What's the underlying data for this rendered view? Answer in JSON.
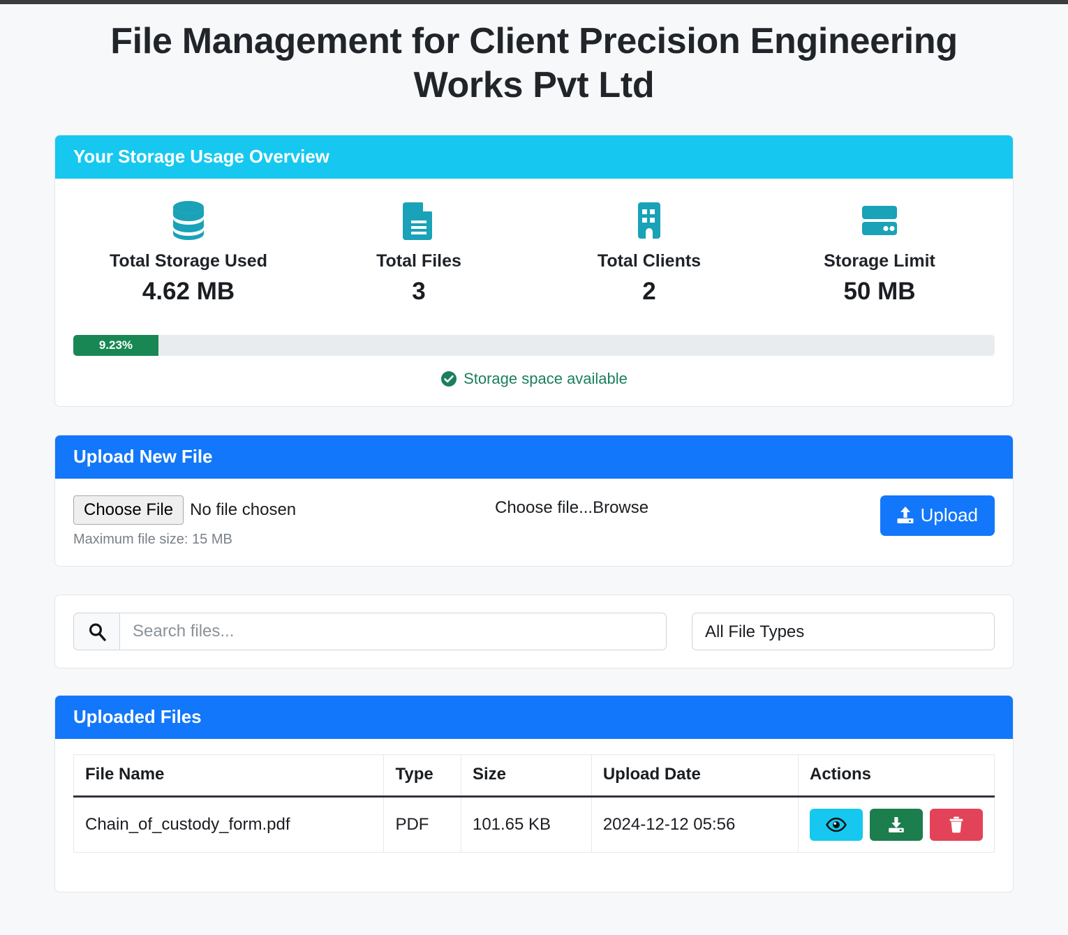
{
  "page": {
    "title": "File Management for Client Precision Engineering Works Pvt Ltd",
    "background_color": "#f6f8fa"
  },
  "storage_card": {
    "header": "Your Storage Usage Overview",
    "header_color": "#16c8ef",
    "stats": [
      {
        "icon": "database-icon",
        "label": "Total Storage Used",
        "value": "4.62 MB"
      },
      {
        "icon": "file-document-icon",
        "label": "Total Files",
        "value": "3"
      },
      {
        "icon": "building-icon",
        "label": "Total Clients",
        "value": "2"
      },
      {
        "icon": "hard-drive-icon",
        "label": "Storage Limit",
        "value": "50 MB"
      }
    ],
    "progress": {
      "label": "9.23%",
      "percent": 9.23,
      "bar_color": "#198754",
      "track_color": "#e9ecef"
    },
    "status_note": {
      "icon": "check-circle-icon",
      "text": "Storage space available",
      "color": "#1a7f5a"
    }
  },
  "upload_card": {
    "header": "Upload New File",
    "header_color": "#1277fa",
    "file_input": {
      "button_label": "Choose File",
      "status_text": "No file chosen"
    },
    "browse_label": "Choose file...Browse",
    "max_size_note": "Maximum file size: 15 MB",
    "upload_button": {
      "label": "Upload",
      "icon": "upload-icon",
      "color": "#1277fa"
    }
  },
  "filters": {
    "search": {
      "icon": "search-icon",
      "value": "",
      "placeholder": "Search files..."
    },
    "file_type_select": {
      "selected": "All File Types",
      "options": [
        "All File Types"
      ]
    }
  },
  "files_card": {
    "header": "Uploaded Files",
    "header_color": "#1277fa",
    "columns": [
      "File Name",
      "Type",
      "Size",
      "Upload Date",
      "Actions"
    ],
    "rows": [
      {
        "name": "Chain_of_custody_form.pdf",
        "type": "PDF",
        "size": "101.65 KB",
        "date": "2024-12-12 05:56",
        "actions": [
          {
            "name": "view",
            "icon": "eye-icon",
            "color": "#16c8ef"
          },
          {
            "name": "download",
            "icon": "download-icon",
            "color": "#1c7d4d"
          },
          {
            "name": "delete",
            "icon": "trash-icon",
            "color": "#e34358"
          }
        ]
      }
    ]
  }
}
